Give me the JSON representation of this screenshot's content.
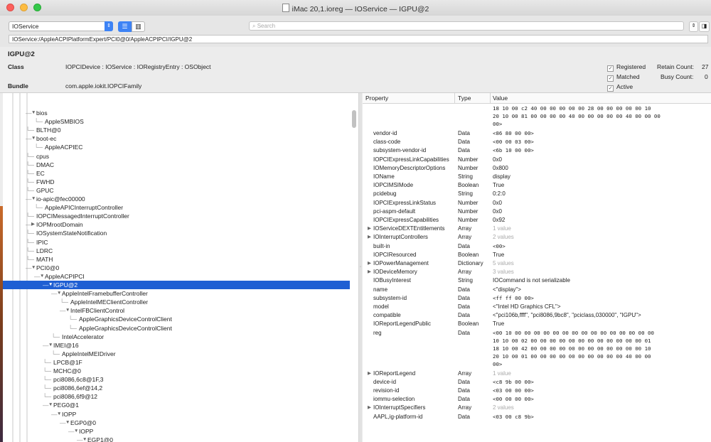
{
  "window": {
    "title": "iMac 20,1.ioreg — IOService — IGPU@2"
  },
  "toolbar": {
    "plane": "IOService",
    "search_placeholder": "Search",
    "path": "IOService:/AppleACPIPlatformExpert/PCI0@0/AppleACPIPCI/IGPU@2"
  },
  "info": {
    "name": "IGPU@2",
    "class_label": "Class",
    "class_value": "IOPCIDevice : IOService : IORegistryEntry : OSObject",
    "bundle_label": "Bundle",
    "bundle_value": "com.apple.iokit.IOPCIFamily",
    "registered": "Registered",
    "matched": "Matched",
    "active": "Active",
    "retain_label": "Retain Count:",
    "retain_value": "27",
    "busy_label": "Busy Count:",
    "busy_value": "0"
  },
  "tree": [
    {
      "label": "bios",
      "depth": 0,
      "tri": "▼"
    },
    {
      "label": "AppleSMBIOS",
      "depth": 1,
      "tri": ""
    },
    {
      "label": "BLTH@0",
      "depth": 0,
      "tri": ""
    },
    {
      "label": "boot-ec",
      "depth": 0,
      "tri": "▼"
    },
    {
      "label": "AppleACPIEC",
      "depth": 1,
      "tri": ""
    },
    {
      "label": "cpus",
      "depth": 0,
      "tri": ""
    },
    {
      "label": "DMAC",
      "depth": 0,
      "tri": ""
    },
    {
      "label": "EC",
      "depth": 0,
      "tri": ""
    },
    {
      "label": "FWHD",
      "depth": 0,
      "tri": ""
    },
    {
      "label": "GPUC",
      "depth": 0,
      "tri": ""
    },
    {
      "label": "io-apic@fec00000",
      "depth": 0,
      "tri": "▼"
    },
    {
      "label": "AppleAPICInterruptController",
      "depth": 1,
      "tri": ""
    },
    {
      "label": "IOPCIMessagedInterruptController",
      "depth": 0,
      "tri": ""
    },
    {
      "label": "IOPMrootDomain",
      "depth": 0,
      "tri": "▶"
    },
    {
      "label": "IOSystemStateNotification",
      "depth": 0,
      "tri": ""
    },
    {
      "label": "IPIC",
      "depth": 0,
      "tri": ""
    },
    {
      "label": "LDRC",
      "depth": 0,
      "tri": ""
    },
    {
      "label": "MATH",
      "depth": 0,
      "tri": ""
    },
    {
      "label": "PCI0@0",
      "depth": 0,
      "tri": "▼"
    },
    {
      "label": "AppleACPIPCI",
      "depth": 1,
      "tri": "▼"
    },
    {
      "label": "IGPU@2",
      "depth": 2,
      "tri": "▼",
      "selected": true
    },
    {
      "label": "AppleIntelFramebufferController",
      "depth": 3,
      "tri": "▼"
    },
    {
      "label": "AppleIntelMEClientController",
      "depth": 4,
      "tri": ""
    },
    {
      "label": "IntelFBClientControl",
      "depth": 4,
      "tri": "▼"
    },
    {
      "label": "AppleGraphicsDeviceControlClient",
      "depth": 5,
      "tri": ""
    },
    {
      "label": "AppleGraphicsDeviceControlClient",
      "depth": 5,
      "tri": ""
    },
    {
      "label": "IntelAccelerator",
      "depth": 3,
      "tri": ""
    },
    {
      "label": "IMEI@16",
      "depth": 2,
      "tri": "▼"
    },
    {
      "label": "AppleIntelMEIDriver",
      "depth": 3,
      "tri": ""
    },
    {
      "label": "LPCB@1F",
      "depth": 2,
      "tri": ""
    },
    {
      "label": "MCHC@0",
      "depth": 2,
      "tri": ""
    },
    {
      "label": "pci8086,6c8@1F,3",
      "depth": 2,
      "tri": ""
    },
    {
      "label": "pci8086,6ef@14,2",
      "depth": 2,
      "tri": ""
    },
    {
      "label": "pci8086,6f9@12",
      "depth": 2,
      "tri": ""
    },
    {
      "label": "PEG0@1",
      "depth": 2,
      "tri": "▼"
    },
    {
      "label": "IOPP",
      "depth": 3,
      "tri": "▼"
    },
    {
      "label": "EGP0@0",
      "depth": 4,
      "tri": "▼"
    },
    {
      "label": "IOPP",
      "depth": 5,
      "tri": "▼"
    },
    {
      "label": "EGP1@0",
      "depth": 6,
      "tri": "▼"
    }
  ],
  "props_header": {
    "property": "Property",
    "type": "Type",
    "value": "Value"
  },
  "props": [
    {
      "name": "",
      "type": "",
      "value": "18 10 00 c2 40 00 00 00 00 00 28 00 00 00 00 00 10\n20 10 00 81 00 00 00 00 40 00 00 00 00 00 40 00 00 00\n00>",
      "lines": 3,
      "mono": true
    },
    {
      "name": "vendor-id",
      "type": "Data",
      "value": "<86 80 00 00>",
      "mono": true
    },
    {
      "name": "class-code",
      "type": "Data",
      "value": "<00 00 03 00>",
      "mono": true
    },
    {
      "name": "subsystem-vendor-id",
      "type": "Data",
      "value": "<6b 10 00 00>",
      "mono": true
    },
    {
      "name": "IOPCIExpressLinkCapabilities",
      "type": "Number",
      "value": "0x0"
    },
    {
      "name": "IOMemoryDescriptorOptions",
      "type": "Number",
      "value": "0x800"
    },
    {
      "name": "IOName",
      "type": "String",
      "value": "display"
    },
    {
      "name": "IOPCIMSIMode",
      "type": "Boolean",
      "value": "True"
    },
    {
      "name": "pcidebug",
      "type": "String",
      "value": "0:2:0"
    },
    {
      "name": "IOPCIExpressLinkStatus",
      "type": "Number",
      "value": "0x0"
    },
    {
      "name": "pci-aspm-default",
      "type": "Number",
      "value": "0x0"
    },
    {
      "name": "IOPCIExpressCapabilities",
      "type": "Number",
      "value": "0x92"
    },
    {
      "name": "IOServiceDEXTEntitlements",
      "type": "Array",
      "value": "1 value",
      "expand": true,
      "gray": true
    },
    {
      "name": "IOInterruptControllers",
      "type": "Array",
      "value": "2 values",
      "expand": true,
      "gray": true
    },
    {
      "name": "built-in",
      "type": "Data",
      "value": "<00>",
      "mono": true
    },
    {
      "name": "IOPCIResourced",
      "type": "Boolean",
      "value": "True"
    },
    {
      "name": "IOPowerManagement",
      "type": "Dictionary",
      "value": "5 values",
      "expand": true,
      "gray": true
    },
    {
      "name": "IODeviceMemory",
      "type": "Array",
      "value": "3 values",
      "expand": true,
      "gray": true
    },
    {
      "name": "IOBusyInterest",
      "type": "String",
      "value": "IOCommand is not serializable"
    },
    {
      "name": "name",
      "type": "Data",
      "value": "<\"display\">"
    },
    {
      "name": "subsystem-id",
      "type": "Data",
      "value": "<ff ff 00 00>",
      "mono": true
    },
    {
      "name": "model",
      "type": "Data",
      "value": "<\"Intel HD Graphics CFL\">"
    },
    {
      "name": "compatible",
      "type": "Data",
      "value": "<\"pci106b,ffff\", \"pci8086,9bc8\", \"pciclass,030000\", \"IGPU\">"
    },
    {
      "name": "IOReportLegendPublic",
      "type": "Boolean",
      "value": "True"
    },
    {
      "name": "reg",
      "type": "Data",
      "value": "<00 10 00 00 00 00 00 00 00 00 00 00 00 00 00 00 00\n10 10 00 02 00 00 00 00 00 00 00 00 00 00 00 00 01\n18 10 00 42 00 00 00 00 00 00 00 00 00 00 00 00 10\n20 10 00 01 00 00 00 00 00 00 00 00 00 00 40 00 00\n00>",
      "lines": 5,
      "mono": true
    },
    {
      "name": "IOReportLegend",
      "type": "Array",
      "value": "1 value",
      "expand": true,
      "gray": true
    },
    {
      "name": "device-id",
      "type": "Data",
      "value": "<c8 9b 00 00>",
      "mono": true
    },
    {
      "name": "revision-id",
      "type": "Data",
      "value": "<03 00 00 00>",
      "mono": true
    },
    {
      "name": "iommu-selection",
      "type": "Data",
      "value": "<00 00 00 00>",
      "mono": true
    },
    {
      "name": "IOInterruptSpecifiers",
      "type": "Array",
      "value": "2 values",
      "expand": true,
      "gray": true
    },
    {
      "name": "AAPL,ig-platform-id",
      "type": "Data",
      "value": "<03 00 c8 9b>",
      "mono": true
    }
  ]
}
